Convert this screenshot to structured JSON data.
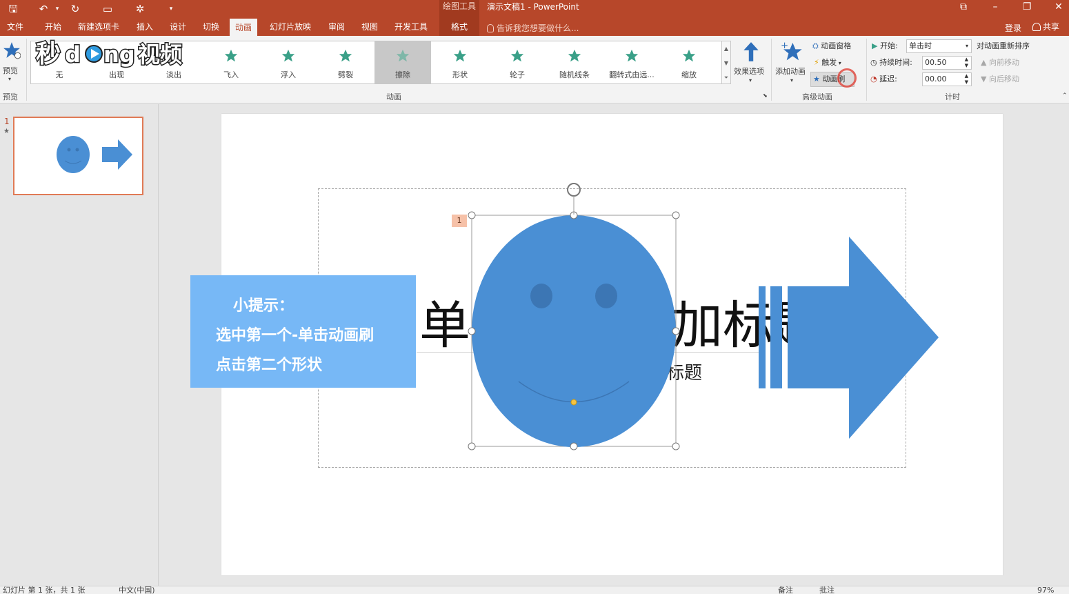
{
  "titlebar": {
    "context_tools": "绘图工具",
    "document_title": "演示文稿1 - PowerPoint"
  },
  "tabs": [
    "文件",
    "开始",
    "新建选项卡",
    "插入",
    "设计",
    "切换",
    "动画",
    "幻灯片放映",
    "审阅",
    "视图",
    "开发工具",
    "格式"
  ],
  "tell_me": "告诉我您想要做什么...",
  "account": {
    "login": "登录",
    "share": "共享"
  },
  "ribbon": {
    "preview": {
      "label": "预览",
      "group": "预览"
    },
    "animation_gallery": {
      "group": "动画",
      "items": [
        "无",
        "出现",
        "淡出",
        "飞入",
        "浮入",
        "劈裂",
        "擦除",
        "形状",
        "轮子",
        "随机线条",
        "翻转式由远...",
        "缩放"
      ],
      "selected": "擦除",
      "accent": "#3aa088"
    },
    "effect_options": "效果选项",
    "advanced": {
      "group": "高级动画",
      "add_animation": "添加动画",
      "animation_pane": "动画窗格",
      "trigger": "触发",
      "painter": "动画刷"
    },
    "timing": {
      "group": "计时",
      "start_label": "开始:",
      "start_value": "单击时",
      "duration_label": "持续时间:",
      "duration_value": "00.50",
      "delay_label": "延迟:",
      "delay_value": "00.00",
      "reorder": "对动画重新排序",
      "move_earlier": "向前移动",
      "move_later": "向后移动"
    }
  },
  "watermark": "秒懂视频",
  "slide_panel": {
    "slide_number": "1",
    "star": "★"
  },
  "slide": {
    "title_left": "单击",
    "title_right": "加标题",
    "subtitle_fragment": "标题",
    "animation_badge": "1",
    "tip": {
      "heading": "小提示：",
      "line1": "选中第一个-单击动画刷",
      "line2": "点击第二个形状"
    },
    "shape_color": "#4a8fd4",
    "tip_color": "#77b8f6"
  },
  "statusbar": {
    "slide_info": "幻灯片 第 1 张，共 1 张",
    "language": "中文(中国)",
    "notes": "备注",
    "comments": "批注",
    "zoom": "97%"
  },
  "colors": {
    "ppt_orange": "#b7472a",
    "ribbon_bg": "#f3f3f3"
  }
}
